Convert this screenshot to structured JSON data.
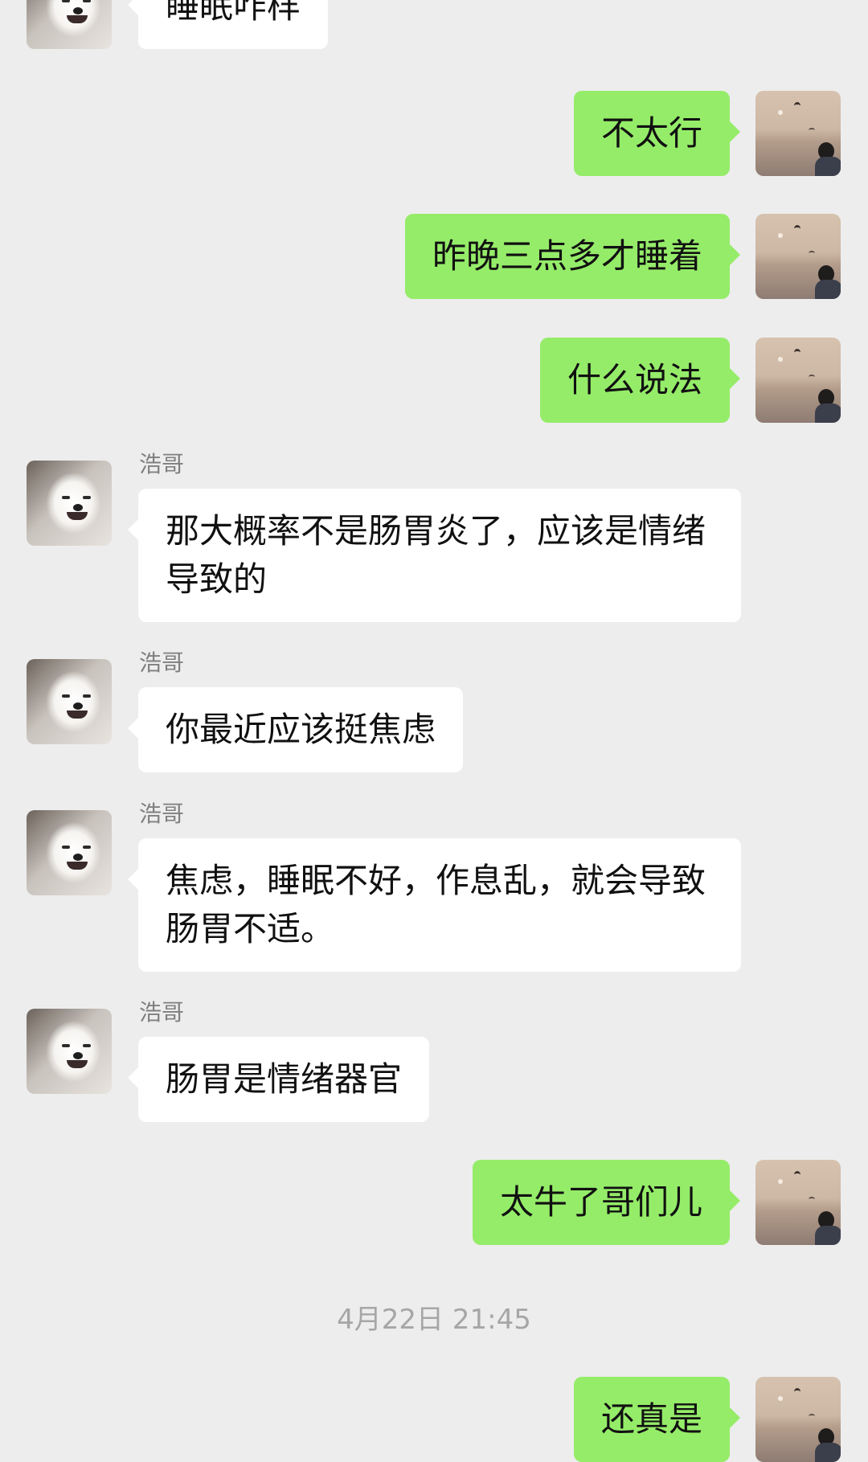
{
  "chat": {
    "messages": [
      {
        "side": "left",
        "text": "睡眠咋样",
        "avatar": "samoyed-dog"
      },
      {
        "side": "right",
        "text": "不太行",
        "avatar": "sunset-sea"
      },
      {
        "side": "right",
        "text": "昨晚三点多才睡着",
        "avatar": "sunset-sea"
      },
      {
        "side": "right",
        "text": "什么说法",
        "avatar": "sunset-sea"
      },
      {
        "side": "left",
        "sender": "浩哥",
        "text": "那大概率不是肠胃炎了，应该是情绪导致的",
        "avatar": "samoyed-dog"
      },
      {
        "side": "left",
        "sender": "浩哥",
        "text": "你最近应该挺焦虑",
        "avatar": "samoyed-dog"
      },
      {
        "side": "left",
        "sender": "浩哥",
        "text": "焦虑，睡眠不好，作息乱，就会导致肠胃不适。",
        "avatar": "samoyed-dog"
      },
      {
        "side": "left",
        "sender": "浩哥",
        "text": "肠胃是情绪器官",
        "avatar": "samoyed-dog"
      },
      {
        "side": "right",
        "text": "太牛了哥们儿",
        "avatar": "sunset-sea"
      },
      {
        "side": "right",
        "text": "还真是",
        "avatar": "sunset-sea"
      }
    ],
    "timestamp": "4月22日 21:45"
  },
  "colors": {
    "background": "#ededed",
    "incoming_bubble": "#ffffff",
    "outgoing_bubble": "#95ec69",
    "sender_name": "#7f7f7f",
    "timestamp": "#a6a6a6"
  }
}
